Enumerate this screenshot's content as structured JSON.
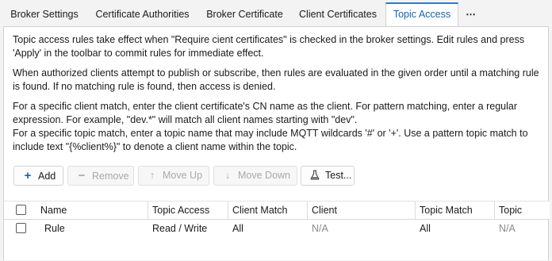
{
  "tabs": [
    {
      "label": "Broker Settings",
      "active": false
    },
    {
      "label": "Certificate Authorities",
      "active": false
    },
    {
      "label": "Broker Certificate",
      "active": false
    },
    {
      "label": "Client Certificates",
      "active": false
    },
    {
      "label": "Topic Access",
      "active": true
    }
  ],
  "overflow_icon": "more-horizontal-icon",
  "description": {
    "p1": "Topic access rules take effect when \"Require cient certificates\" is checked in the broker settings. Edit rules and press 'Apply' in the toolbar to commit rules for immediate effect.",
    "p2": "When authorized clients attempt to publish or subscribe, then rules are evaluated in the given order until a matching rule is found. If no matching rule is found, then access is denied.",
    "p3_line1": "For a specific client match, enter the client certificate's CN name as the client. For pattern matching, enter a regular expression. For example, \"dev.*\" will match all client names starting with \"dev\".",
    "p3_line2": "For a specific topic match, enter a topic name that may include MQTT wildcards '#' or '+'. Use a pattern topic match to include text \"{%client%}\" to denote a client name within the topic."
  },
  "toolbar": {
    "add": {
      "label": "Add",
      "icon": "plus-icon",
      "enabled": true
    },
    "remove": {
      "label": "Remove",
      "icon": "minus-icon",
      "enabled": false
    },
    "move_up": {
      "label": "Move Up",
      "icon": "arrow-up-icon",
      "enabled": false
    },
    "move_down": {
      "label": "Move Down",
      "icon": "arrow-down-icon",
      "enabled": false
    },
    "test": {
      "label": "Test...",
      "icon": "flask-icon",
      "enabled": true
    }
  },
  "table": {
    "columns": [
      "Name",
      "Topic Access",
      "Client Match",
      "Client",
      "Topic Match",
      "Topic"
    ],
    "rows": [
      {
        "checked": false,
        "name": "Rule",
        "topic_access": "Read / Write",
        "client_match": "All",
        "client": "N/A",
        "topic_match": "All",
        "topic": "N/A"
      }
    ]
  },
  "colors": {
    "accent": "#2b7cd3",
    "active_tab_text": "#1464b4",
    "disabled_text": "#a8a8a8",
    "add_icon": "#1f5fa8"
  }
}
